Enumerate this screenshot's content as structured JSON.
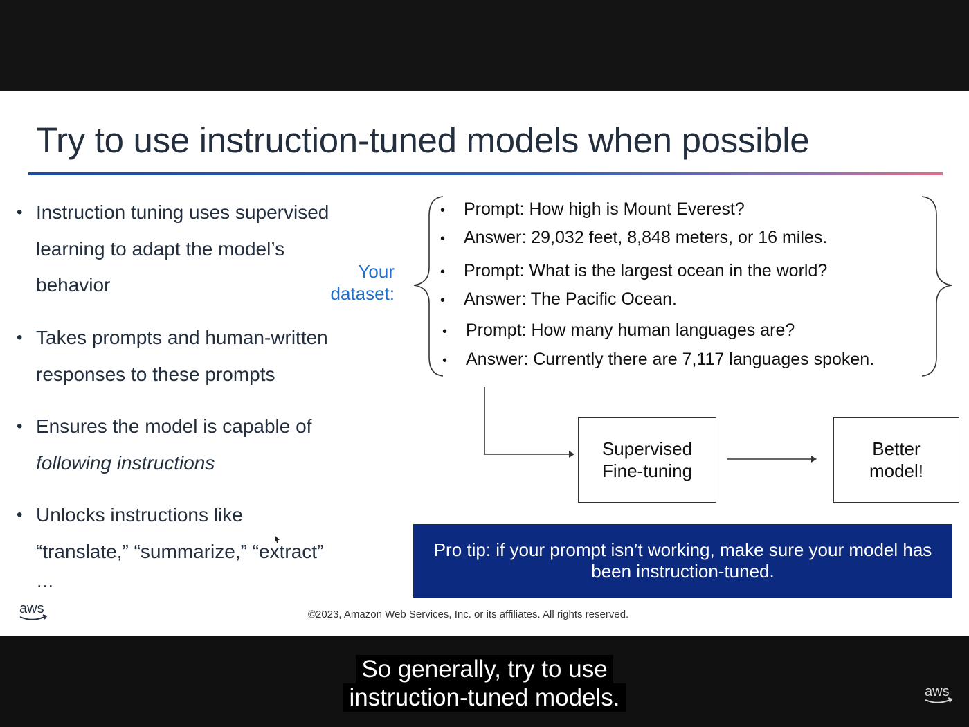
{
  "slide": {
    "title": "Try to use instruction-tuned models when possible",
    "bullets": {
      "b1": [
        "Instruction tuning uses supervised",
        "learning to adapt the model’s",
        "behavior"
      ],
      "b2": [
        "Takes prompts and human-written",
        "responses to these prompts"
      ],
      "b3": [
        "Ensures the model is capable of",
        "following instructions"
      ],
      "b4": [
        "Unlocks instructions like",
        "“translate,” “summarize,” “extract”"
      ]
    },
    "ellipsis": "…",
    "dataset_label": [
      "Your",
      "dataset:"
    ],
    "examples": [
      "Prompt: How high is Mount Everest?",
      "Answer: 29,032 feet, 8,848 meters, or 16 miles.",
      "Prompt: What is the largest ocean in the world?",
      "Answer: The Pacific Ocean.",
      "Prompt: How many human languages are?",
      "Answer: Currently there are 7,117 languages spoken."
    ],
    "flow": {
      "sft": [
        "Supervised",
        "Fine-tuning"
      ],
      "result": [
        "Better",
        "model!"
      ]
    },
    "pro_tip": [
      "Pro tip: if your prompt isn’t working, make sure your model has",
      "been instruction-tuned."
    ],
    "copyright": "©2023, Amazon Web Services, Inc. or its affiliates. All rights reserved.",
    "logo_text": "aws"
  },
  "caption": {
    "line1": "So generally, try to use",
    "line2": "instruction-tuned models."
  },
  "colors": {
    "title": "#232f3e",
    "dataset_label": "#1f6fd1",
    "pro_tip_bg": "#0b2a80"
  }
}
